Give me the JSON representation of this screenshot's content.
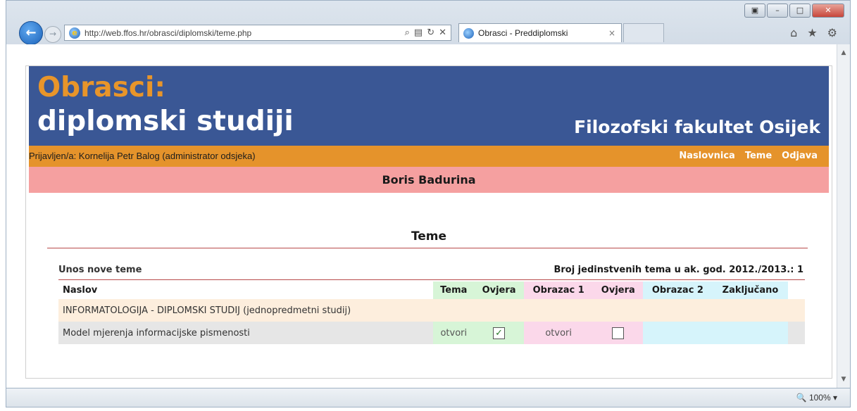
{
  "browser": {
    "url": "http://web.ffos.hr/obrasci/diplomski/teme.php",
    "tab_title": "Obrasci - Preddiplomski",
    "zoom": "100%"
  },
  "banner": {
    "title_line1": "Obrasci:",
    "title_line2": "diplomski studiji",
    "faculty": "Filozofski fakultet Osijek"
  },
  "userbar": {
    "login": "Prijavljen/a: Kornelija Petr Balog (administrator odsjeka)",
    "nav": [
      "Naslovnica",
      "Teme",
      "Odjava"
    ]
  },
  "person_name": "Boris Badurina",
  "section_title": "Teme",
  "actions": {
    "new_topic": "Unos nove teme",
    "count_text": "Broj jedinstvenih tema u ak. god. 2012./2013.: 1"
  },
  "table": {
    "headers": [
      "Naslov",
      "Tema",
      "Ovjera",
      "Obrazac 1",
      "Ovjera",
      "Obrazac 2",
      "Zaključano"
    ],
    "group": "INFORMATOLOGIJA - DIPLOMSKI STUDIJ (jednopredmetni studij)",
    "rows": [
      {
        "title": "Model mjerenja informacijske pismenosti",
        "tema": "otvori",
        "ovjera1_checked": true,
        "obrazac1": "otvori",
        "ovjera2_checked": false
      }
    ]
  },
  "colors": {
    "banner_bg": "#3a5795",
    "banner_accent": "#e8952a",
    "userbar_bg": "#e5932b",
    "namebar_bg": "#f5a0a0"
  }
}
